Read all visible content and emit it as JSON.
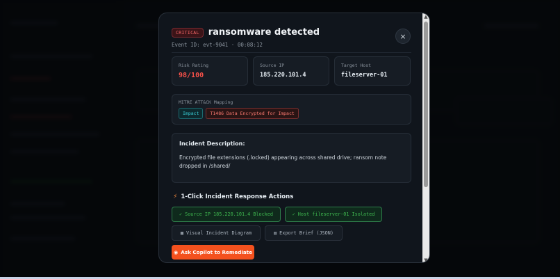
{
  "incident": {
    "severity": "CRITICAL",
    "title": "ransomware detected",
    "event_id": "Event ID: evt-9041 · 00:08:12"
  },
  "stats": [
    {
      "label": "Risk Rating",
      "value": "98/100"
    },
    {
      "label": "Source IP",
      "value": "185.220.101.4"
    },
    {
      "label": "Target Host",
      "value": "fileserver-01"
    }
  ],
  "mitre": {
    "label": "MITRE ATT&CK Mapping",
    "tactic": "Impact",
    "technique": "T1486 Data Encrypted for Impact"
  },
  "description": {
    "title": "Incident Description:",
    "text": "Encrypted file extensions (.locked) appearing across shared drive; ransom note dropped in /shared/"
  },
  "actions": {
    "title": "1-Click Incident Response Actions",
    "block_ip": "Source IP 185.220.101.4 Blocked",
    "isolate_host": "Host fileserver-01 Isolated",
    "visual_diagram": "Visual Incident Diagram",
    "export_brief": "Export Brief (JSON)",
    "copilot": "Ask Copilot to Remediate"
  },
  "icons": {
    "close": "×",
    "bolt": "⚡",
    "check": "✓",
    "diagram": "▦",
    "document": "▤",
    "copilot": "◉"
  },
  "colors": {
    "critical": "#ff6b6b",
    "risk": "#f85149",
    "success": "#3fb950",
    "accent": "#f4511e",
    "tactic": "#39d0d8"
  }
}
